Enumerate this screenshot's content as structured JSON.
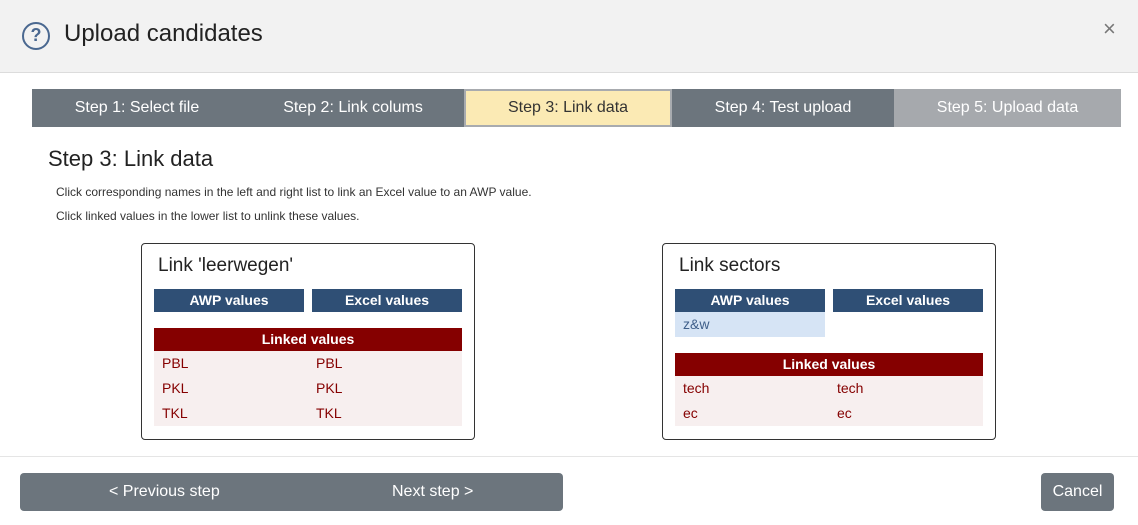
{
  "modal": {
    "title": "Upload candidates",
    "help_icon": "?",
    "close_icon": "×"
  },
  "steps": [
    {
      "label": "Step 1: Select file",
      "state": "done"
    },
    {
      "label": "Step 2: Link colums",
      "state": "done"
    },
    {
      "label": "Step 3: Link data",
      "state": "active"
    },
    {
      "label": "Step 4: Test upload",
      "state": "todo"
    },
    {
      "label": "Step 5: Upload data",
      "state": "disabled"
    }
  ],
  "section": {
    "title": "Step 3: Link data",
    "instructions": [
      "Click corresponding names in the left and right list to link an Excel value to an AWP value.",
      "Click linked values in the lower list to unlink these values."
    ]
  },
  "panels": [
    {
      "title": "Link 'leerwegen'",
      "awp_header": "AWP values",
      "excel_header": "Excel values",
      "awp_values": [],
      "excel_values": [],
      "linked_header": "Linked values",
      "linked": [
        {
          "awp": "PBL",
          "excel": "PBL"
        },
        {
          "awp": "PKL",
          "excel": "PKL"
        },
        {
          "awp": "TKL",
          "excel": "TKL"
        }
      ]
    },
    {
      "title": "Link sectors",
      "awp_header": "AWP values",
      "excel_header": "Excel values",
      "awp_values": [
        "z&w"
      ],
      "excel_values": [],
      "linked_header": "Linked values",
      "linked": [
        {
          "awp": "tech",
          "excel": "tech"
        },
        {
          "awp": "ec",
          "excel": "ec"
        }
      ]
    }
  ],
  "footer": {
    "prev_label": "< Previous step",
    "next_label": "Next step >",
    "cancel_label": "Cancel"
  },
  "colors": {
    "header_blue": "#2f4f75",
    "linked_red": "#850000",
    "active_step": "#fbeab4",
    "button_gray": "#6c757d"
  }
}
